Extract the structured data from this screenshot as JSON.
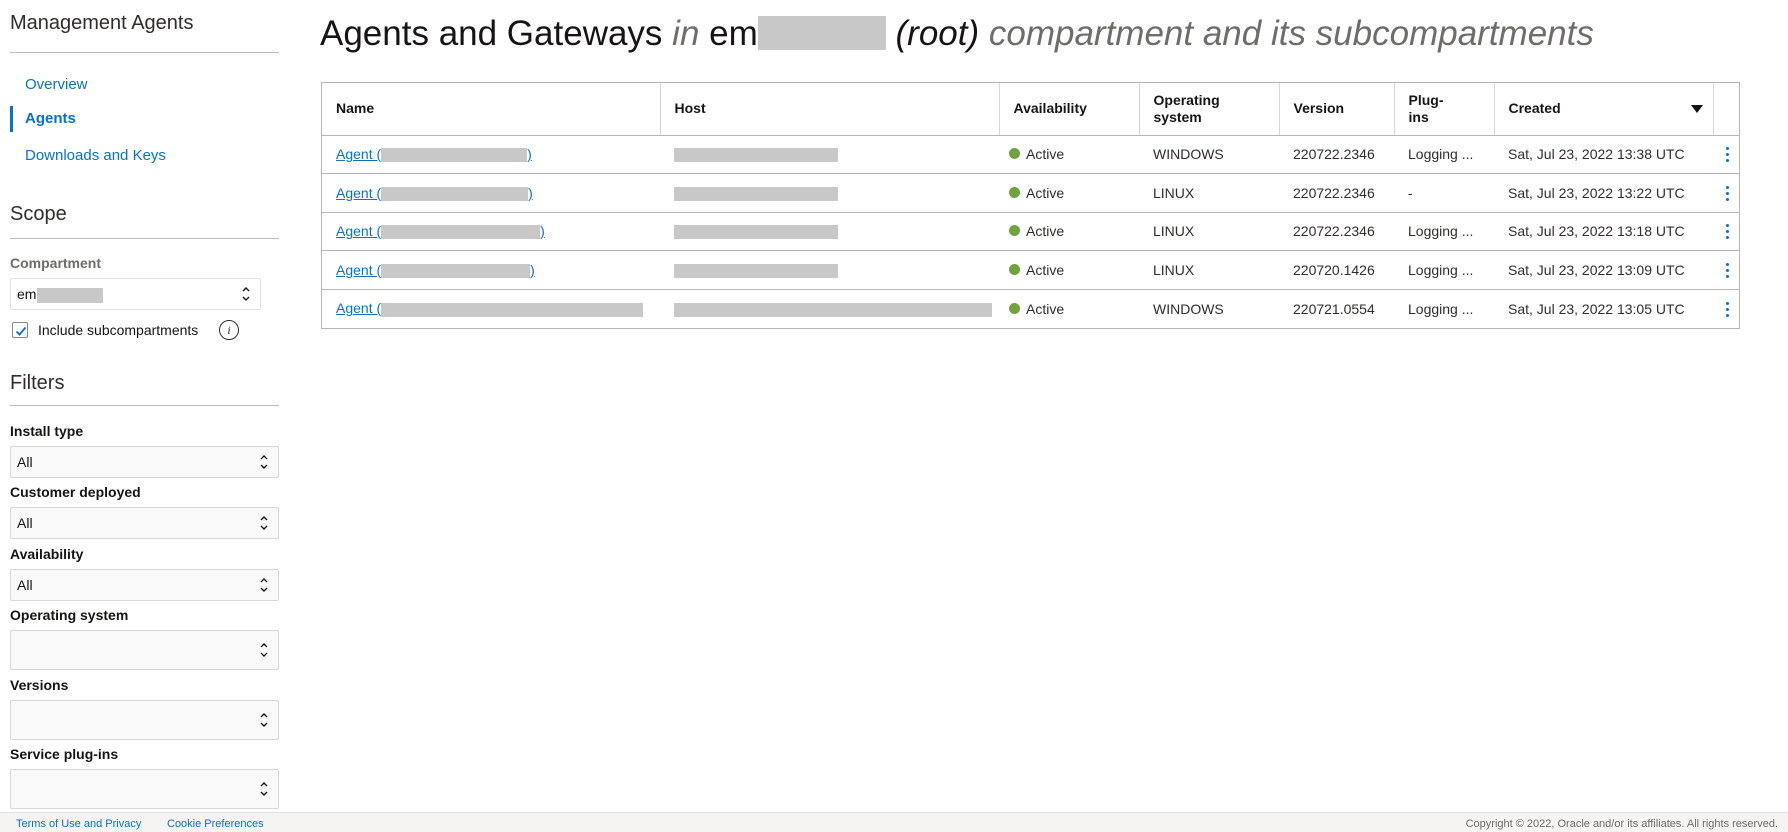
{
  "sidebar": {
    "title": "Management Agents",
    "nav": [
      {
        "label": "Overview"
      },
      {
        "label": "Agents"
      },
      {
        "label": "Downloads and Keys"
      }
    ],
    "scope": {
      "title": "Scope",
      "compartment_label": "Compartment",
      "compartment_value": "em",
      "include_subcompartments_label": "Include subcompartments",
      "include_subcompartments_checked": true
    },
    "filters": {
      "title": "Filters",
      "install_type": {
        "label": "Install type",
        "value": "All"
      },
      "customer_deployed": {
        "label": "Customer deployed",
        "value": "All"
      },
      "availability": {
        "label": "Availability",
        "value": "All"
      },
      "operating_system": {
        "label": "Operating system",
        "value": ""
      },
      "versions": {
        "label": "Versions",
        "value": ""
      },
      "service_plugins": {
        "label": "Service plug-ins",
        "value": ""
      }
    }
  },
  "main": {
    "title_prefix": "Agents and Gateways",
    "title_in": "in",
    "title_comp": "em",
    "title_root": "(root)",
    "title_suffix": "compartment and its subcompartments"
  },
  "table": {
    "columns": {
      "name": "Name",
      "host": "Host",
      "availability": "Availability",
      "os_line1": "Operating",
      "os_line2": "system",
      "version": "Version",
      "plugins_line1": "Plug-",
      "plugins_line2": "ins",
      "created": "Created"
    },
    "rows": [
      {
        "name_prefix": "Agent (",
        "name_suffix": ")",
        "availability": "Active",
        "os": "WINDOWS",
        "version": "220722.2346",
        "plugins": "Logging ...",
        "created": "Sat, Jul 23, 2022 13:38 UTC"
      },
      {
        "name_prefix": "Agent (",
        "name_suffix": ")",
        "availability": "Active",
        "os": "LINUX",
        "version": "220722.2346",
        "plugins": "-",
        "created": "Sat, Jul 23, 2022 13:22 UTC"
      },
      {
        "name_prefix": "Agent (",
        "name_suffix": ")",
        "availability": "Active",
        "os": "LINUX",
        "version": "220722.2346",
        "plugins": "Logging ...",
        "created": "Sat, Jul 23, 2022 13:18 UTC"
      },
      {
        "name_prefix": "Agent (",
        "name_suffix": ")",
        "availability": "Active",
        "os": "LINUX",
        "version": "220720.1426",
        "plugins": "Logging ...",
        "created": "Sat, Jul 23, 2022 13:09 UTC"
      },
      {
        "name_prefix": "Agent (",
        "name_suffix": "",
        "availability": "Active",
        "os": "WINDOWS",
        "version": "220721.0554",
        "plugins": "Logging ...",
        "created": "Sat, Jul 23, 2022 13:05 UTC"
      }
    ]
  },
  "footer": {
    "terms": "Terms of Use and Privacy",
    "cookies": "Cookie Preferences",
    "copyright": "Copyright © 2022, Oracle and/or its affiliates. All rights reserved."
  },
  "colors": {
    "link": "#0572ce",
    "status_active": "#6fa33c",
    "redacted": "#c8c8c8"
  },
  "icons": [
    "select-chevron-icon",
    "checkmark-icon",
    "info-icon",
    "sort-descending-icon",
    "kebab-menu-icon",
    "status-dot-icon"
  ]
}
